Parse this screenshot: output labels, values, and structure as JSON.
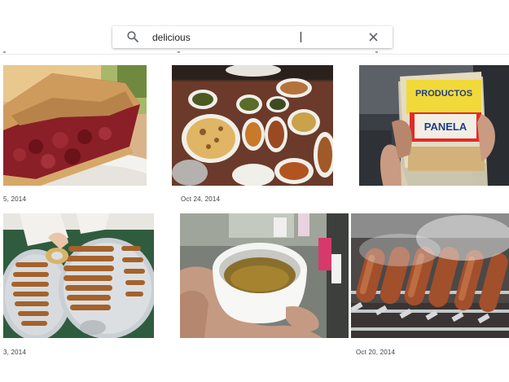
{
  "search": {
    "query": "delicious",
    "search_icon": "search-icon",
    "clear_icon": "close-icon"
  },
  "photos": [
    {
      "name": "cherry-pie-slice",
      "date": "5, 2014"
    },
    {
      "name": "indian-dinner-table",
      "date": "Oct 24, 2014"
    },
    {
      "name": "panela-bag",
      "date": "",
      "label_line1": "PRODUCTOS",
      "label_line2": "PANELA"
    },
    {
      "name": "pastry-platters",
      "date": "3, 2014"
    },
    {
      "name": "cup-of-tea",
      "date": ""
    },
    {
      "name": "kebabs-on-grill",
      "date": "Oct 20, 2014"
    }
  ]
}
